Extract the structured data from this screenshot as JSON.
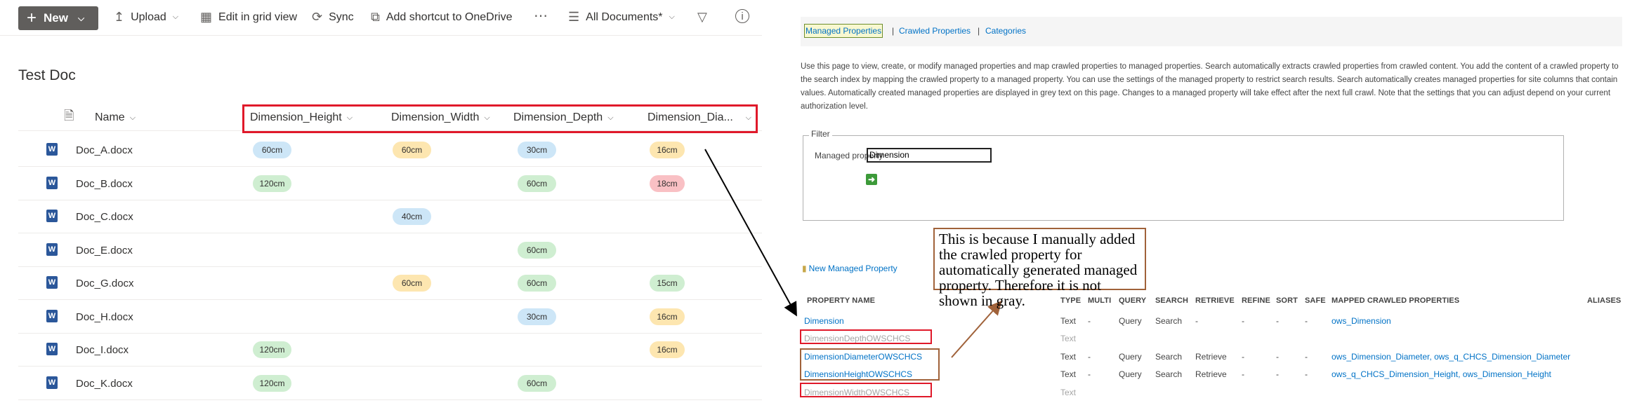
{
  "library": {
    "toolbar": {
      "new_label": "New",
      "upload_label": "Upload",
      "grid_label": "Edit in grid view",
      "sync_label": "Sync",
      "shortcut_label": "Add shortcut to OneDrive",
      "view_label": "All Documents*"
    },
    "title": "Test Doc",
    "columns": [
      "Name",
      "Dimension_Height",
      "Dimension_Width",
      "Dimension_Depth",
      "Dimension_Dia..."
    ],
    "rows": [
      {
        "name": "Doc_A.docx",
        "height": "60cm",
        "width": "60cm",
        "depth": "30cm",
        "diameter": "16cm"
      },
      {
        "name": "Doc_B.docx",
        "height": "120cm",
        "width": "",
        "depth": "60cm",
        "diameter": "18cm"
      },
      {
        "name": "Doc_C.docx",
        "height": "",
        "width": "40cm",
        "depth": "",
        "diameter": ""
      },
      {
        "name": "Doc_E.docx",
        "height": "",
        "width": "",
        "depth": "60cm",
        "diameter": ""
      },
      {
        "name": "Doc_G.docx",
        "height": "",
        "width": "60cm",
        "depth": "60cm",
        "diameter": "15cm"
      },
      {
        "name": "Doc_H.docx",
        "height": "",
        "width": "",
        "depth": "30cm",
        "diameter": "16cm"
      },
      {
        "name": "Doc_I.docx",
        "height": "120cm",
        "width": "",
        "depth": "",
        "diameter": "16cm"
      },
      {
        "name": "Doc_K.docx",
        "height": "120cm",
        "width": "",
        "depth": "60cm",
        "diameter": ""
      }
    ],
    "pill_colors": {
      "blue": "#cde6f7",
      "yellow": "#fde6b0",
      "green": "#cfeed1",
      "red": "#f9c0c4"
    }
  },
  "schema": {
    "tabs": {
      "managed": "Managed Properties",
      "crawled": "Crawled Properties",
      "categories": "Categories",
      "separator": "|"
    },
    "description": "Use this page to view, create, or modify managed properties and map crawled properties to managed properties. Search automatically extracts crawled properties from crawled content. You add the content of a crawled property to the search index by mapping the crawled property to a managed property. You can use the settings of the managed property to restrict search results. Search automatically creates managed properties for site columns that contain values. Automatically created managed properties are displayed in grey text on this page. Changes to a managed property will take effect after the next full crawl. Note that the settings that you can adjust depend on your current authorization level.",
    "filter": {
      "legend": "Filter",
      "label": "Managed property",
      "value": "Dimension"
    },
    "new_property_label": "New Managed Property",
    "callout": "This is because I manually added the crawled property for automatically generated managed property. Therefore it is not shown in gray.",
    "headers": [
      "PROPERTY NAME",
      "TYPE",
      "MULTI",
      "QUERY",
      "SEARCH",
      "RETRIEVE",
      "REFINE",
      "SORT",
      "SAFE",
      "MAPPED CRAWLED PROPERTIES",
      "ALIASES"
    ],
    "properties": [
      {
        "name": "Dimension",
        "type": "Text",
        "multi": "-",
        "query": "Query",
        "search": "Search",
        "retrieve": "-",
        "refine": "-",
        "sort": "-",
        "safe": "-",
        "mapped": "ows_Dimension",
        "auto": false
      },
      {
        "name": "DimensionDepthOWSCHCS",
        "type": "Text",
        "multi": "",
        "query": "",
        "search": "",
        "retrieve": "",
        "refine": "",
        "sort": "",
        "safe": "",
        "mapped": "",
        "auto": true
      },
      {
        "name": "DimensionDiameterOWSCHCS",
        "type": "Text",
        "multi": "-",
        "query": "Query",
        "search": "Search",
        "retrieve": "Retrieve",
        "refine": "-",
        "sort": "-",
        "safe": "-",
        "mapped": "ows_Dimension_Diameter, ows_q_CHCS_Dimension_Diameter",
        "auto": false
      },
      {
        "name": "DimensionHeightOWSCHCS",
        "type": "Text",
        "multi": "-",
        "query": "Query",
        "search": "Search",
        "retrieve": "Retrieve",
        "refine": "-",
        "sort": "-",
        "safe": "-",
        "mapped": "ows_q_CHCS_Dimension_Height, ows_Dimension_Height",
        "auto": false
      },
      {
        "name": "DimensionWidthOWSCHCS",
        "type": "Text",
        "multi": "",
        "query": "",
        "search": "",
        "retrieve": "",
        "refine": "",
        "sort": "",
        "safe": "",
        "mapped": "",
        "auto": true
      }
    ]
  }
}
